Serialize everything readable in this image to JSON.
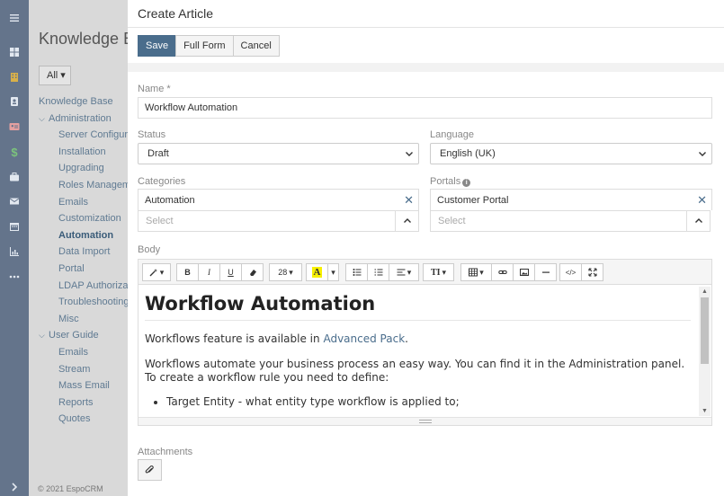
{
  "background": {
    "title": "Knowledge Base",
    "filter_label": "All",
    "tree": {
      "root": "Knowledge Base",
      "administration": {
        "label": "Administration",
        "items": [
          "Server Configuration",
          "Installation",
          "Upgrading",
          "Roles Management",
          "Emails",
          "Customization",
          "Automation",
          "Data Import",
          "Portal",
          "LDAP Authorization",
          "Troubleshooting",
          "Misc"
        ],
        "active": "Automation"
      },
      "user_guide": {
        "label": "User Guide",
        "items": [
          "Emails",
          "Stream",
          "Mass Email",
          "Reports",
          "Quotes"
        ]
      }
    },
    "footer": "© 2021 EspoCRM"
  },
  "sidebar_icons": [
    "menu-icon",
    "dashboard-icon",
    "building-icon",
    "contacts-icon",
    "id-card-icon",
    "dollar-icon",
    "briefcase-icon",
    "envelope-icon",
    "calendar-icon",
    "chart-icon",
    "more-icon",
    "expand-icon"
  ],
  "modal": {
    "title": "Create Article",
    "actions": {
      "save": "Save",
      "full_form": "Full Form",
      "cancel": "Cancel"
    },
    "fields": {
      "name": {
        "label": "Name *",
        "value": "Workflow Automation"
      },
      "status": {
        "label": "Status",
        "value": "Draft"
      },
      "language": {
        "label": "Language",
        "value": "English (UK)"
      },
      "categories": {
        "label": "Categories",
        "selected": "Automation",
        "placeholder": "Select"
      },
      "portals": {
        "label": "Portals",
        "selected": "Customer Portal",
        "placeholder": "Select"
      },
      "body": {
        "label": "Body"
      },
      "attachments": {
        "label": "Attachments"
      }
    },
    "editor": {
      "toolbar": {
        "font_size": "28"
      },
      "heading": "Workflow Automation",
      "p1_text": "Workflows feature is available in ",
      "p1_link": "Advanced Pack",
      "p1_end": ".",
      "p2": "Workflows automate your business process an easy way. You can find it in the Administration panel. To create a workflow rule you need to define:",
      "bullet1": "Target Entity - what entity type workflow is applied to;"
    }
  },
  "colors": {
    "primary": "#4a6d8c",
    "rail": "#64748b",
    "link": "#5f7a92"
  }
}
